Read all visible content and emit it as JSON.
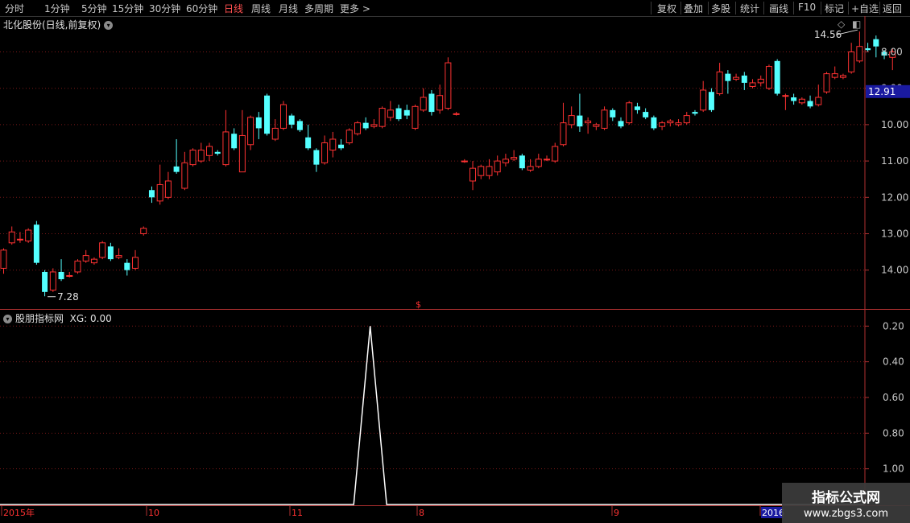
{
  "toolbar": {
    "left": [
      "分时",
      "1分钟",
      "5分钟",
      "15分钟",
      "30分钟",
      "60分钟",
      "日线",
      "周线",
      "月线",
      "多周期",
      "更多 >"
    ],
    "active_index": 6,
    "right": [
      "复权",
      "叠加",
      "多股",
      "统计",
      "画线",
      "F10",
      "标记",
      "+自选",
      "返回"
    ]
  },
  "main_panel": {
    "title": "北化股份(日线,前复权)",
    "current_price_label": "12.91",
    "high_label": "14.56",
    "low_label": "7.28",
    "signal_marker": "$",
    "y_ticks": [
      "14.00",
      "13.00",
      "12.00",
      "11.00",
      "10.00",
      "9.00",
      "8.00"
    ]
  },
  "indicator_panel": {
    "title": "股朋指标网",
    "readout": "XG: 0.00",
    "y_ticks": [
      "1.00",
      "0.80",
      "0.60",
      "0.40",
      "0.20"
    ]
  },
  "date_axis": {
    "labels": [
      "2015年",
      "10",
      "11",
      "8",
      "9",
      "2016"
    ]
  },
  "watermark": {
    "line1": "指标公式网",
    "line2": "www.zbgs3.com"
  },
  "colors": {
    "up": "#ff3232",
    "down": "#54ffff",
    "axis": "#b03030",
    "grid": "#7a1818",
    "text": "#c8c8c8",
    "highlight_bg": "#1a1aa0"
  },
  "chart_data": [
    {
      "type": "candlestick",
      "title": "北化股份(日线,前复权)",
      "ylim": [
        7.0,
        14.7
      ],
      "y_ticks": [
        8,
        9,
        10,
        11,
        12,
        13,
        14
      ],
      "current_price": 12.91,
      "max_label": 14.56,
      "min_label": 7.28,
      "candles": [
        [
          8.05,
          8.55,
          8.6,
          7.9
        ],
        [
          8.75,
          9.05,
          9.2,
          8.7
        ],
        [
          8.85,
          8.85,
          9.05,
          8.75
        ],
        [
          8.8,
          9.1,
          9.15,
          8.75
        ],
        [
          9.25,
          8.2,
          9.35,
          8.15
        ],
        [
          7.95,
          7.4,
          8.0,
          7.28
        ],
        [
          7.45,
          7.95,
          8.05,
          7.4
        ],
        [
          7.95,
          7.75,
          8.3,
          7.7
        ],
        [
          7.85,
          7.85,
          7.95,
          7.8
        ],
        [
          7.95,
          8.25,
          8.3,
          7.9
        ],
        [
          8.25,
          8.4,
          8.55,
          8.2
        ],
        [
          8.2,
          8.3,
          8.35,
          8.15
        ],
        [
          8.35,
          8.75,
          8.8,
          8.3
        ],
        [
          8.65,
          8.3,
          8.75,
          8.25
        ],
        [
          8.35,
          8.4,
          8.6,
          8.3
        ],
        [
          8.2,
          8.0,
          8.3,
          7.85
        ],
        [
          8.05,
          8.35,
          8.55,
          8.0
        ],
        [
          9.0,
          9.15,
          9.2,
          8.95
        ],
        [
          10.2,
          10.0,
          10.3,
          9.85
        ],
        [
          9.9,
          10.35,
          10.9,
          9.8
        ],
        [
          10.0,
          10.45,
          10.7,
          9.95
        ],
        [
          10.85,
          10.7,
          11.6,
          10.65
        ],
        [
          10.25,
          10.95,
          11.25,
          10.2
        ],
        [
          10.9,
          11.3,
          11.35,
          10.85
        ],
        [
          11.0,
          11.3,
          11.5,
          10.95
        ],
        [
          11.15,
          11.4,
          11.5,
          11.0
        ],
        [
          11.25,
          11.2,
          11.3,
          11.15
        ],
        [
          10.9,
          11.8,
          12.4,
          10.85
        ],
        [
          11.75,
          11.35,
          11.9,
          11.3
        ],
        [
          10.7,
          11.7,
          12.4,
          10.7
        ],
        [
          11.45,
          12.2,
          12.25,
          11.3
        ],
        [
          12.2,
          11.9,
          12.35,
          11.6
        ],
        [
          12.8,
          11.75,
          12.85,
          11.7
        ],
        [
          11.6,
          11.9,
          12.15,
          11.55
        ],
        [
          11.9,
          12.55,
          12.65,
          11.85
        ],
        [
          12.25,
          12.0,
          12.3,
          11.9
        ],
        [
          12.1,
          11.85,
          12.15,
          11.8
        ],
        [
          11.65,
          11.35,
          12.0,
          11.3
        ],
        [
          11.3,
          10.9,
          11.35,
          10.7
        ],
        [
          10.95,
          11.5,
          11.7,
          10.9
        ],
        [
          11.3,
          11.6,
          11.8,
          11.1
        ],
        [
          11.45,
          11.35,
          11.6,
          11.3
        ],
        [
          11.5,
          11.85,
          11.9,
          11.45
        ],
        [
          11.75,
          12.05,
          12.1,
          11.7
        ],
        [
          12.05,
          11.9,
          12.2,
          11.85
        ],
        [
          11.95,
          12.0,
          12.15,
          11.9
        ],
        [
          11.95,
          12.45,
          12.5,
          11.9
        ],
        [
          12.2,
          12.4,
          12.65,
          12.1
        ],
        [
          12.45,
          12.15,
          12.55,
          12.1
        ],
        [
          12.4,
          12.25,
          12.55,
          12.15
        ],
        [
          11.9,
          12.5,
          12.55,
          11.85
        ],
        [
          12.4,
          12.75,
          13.0,
          12.35
        ],
        [
          12.85,
          12.35,
          12.95,
          12.25
        ],
        [
          12.4,
          12.8,
          13.1,
          12.3
        ],
        [
          12.45,
          13.7,
          13.85,
          12.4
        ],
        [
          12.3,
          12.3,
          12.35,
          12.25
        ],
        [
          11.0,
          11.0,
          11.05,
          10.95
        ],
        [
          10.45,
          10.8,
          11.0,
          10.2
        ],
        [
          10.6,
          10.85,
          10.9,
          10.5
        ],
        [
          10.6,
          10.85,
          11.05,
          10.5
        ],
        [
          10.7,
          11.0,
          11.15,
          10.6
        ],
        [
          10.95,
          11.05,
          11.2,
          10.85
        ],
        [
          11.05,
          11.1,
          11.3,
          11.0
        ],
        [
          11.15,
          10.8,
          11.2,
          10.75
        ],
        [
          10.75,
          10.85,
          11.05,
          10.7
        ],
        [
          10.85,
          11.05,
          11.2,
          10.8
        ],
        [
          11.05,
          11.05,
          11.15,
          11.0
        ],
        [
          11.0,
          11.4,
          11.5,
          10.95
        ],
        [
          11.45,
          12.05,
          12.6,
          11.4
        ],
        [
          12.0,
          12.25,
          12.5,
          11.9
        ],
        [
          12.25,
          11.95,
          12.85,
          11.8
        ],
        [
          12.05,
          12.1,
          12.2,
          11.75
        ],
        [
          11.95,
          12.0,
          12.05,
          11.85
        ],
        [
          11.9,
          12.4,
          12.5,
          11.85
        ],
        [
          12.4,
          12.2,
          12.45,
          12.1
        ],
        [
          12.1,
          11.95,
          12.2,
          11.9
        ],
        [
          12.05,
          12.6,
          12.65,
          12.0
        ],
        [
          12.5,
          12.4,
          12.6,
          12.3
        ],
        [
          12.35,
          12.2,
          12.45,
          12.15
        ],
        [
          12.2,
          11.9,
          12.25,
          11.85
        ],
        [
          11.95,
          12.05,
          12.1,
          11.85
        ],
        [
          12.05,
          12.1,
          12.15,
          11.95
        ],
        [
          12.0,
          12.05,
          12.15,
          11.95
        ],
        [
          12.05,
          12.25,
          12.35,
          12.0
        ],
        [
          12.35,
          12.3,
          12.4,
          12.25
        ],
        [
          12.4,
          12.95,
          13.2,
          12.35
        ],
        [
          12.9,
          12.4,
          13.0,
          12.35
        ],
        [
          12.85,
          13.45,
          13.7,
          12.8
        ],
        [
          13.4,
          13.2,
          13.5,
          12.85
        ],
        [
          13.25,
          13.3,
          13.4,
          13.2
        ],
        [
          13.35,
          13.15,
          13.45,
          12.95
        ],
        [
          13.05,
          13.15,
          13.25,
          13.0
        ],
        [
          13.15,
          13.25,
          13.35,
          13.05
        ],
        [
          13.0,
          13.6,
          13.65,
          12.95
        ],
        [
          13.75,
          12.85,
          13.8,
          12.8
        ],
        [
          12.8,
          12.8,
          12.85,
          12.4
        ],
        [
          12.75,
          12.65,
          12.85,
          12.55
        ],
        [
          12.6,
          12.7,
          12.75,
          12.55
        ],
        [
          12.65,
          12.5,
          12.8,
          12.45
        ],
        [
          12.55,
          12.75,
          13.1,
          12.5
        ],
        [
          12.9,
          13.4,
          13.45,
          12.85
        ],
        [
          13.3,
          13.4,
          13.6,
          13.25
        ],
        [
          13.3,
          13.35,
          13.4,
          13.25
        ],
        [
          13.45,
          14.0,
          14.25,
          13.4
        ],
        [
          13.75,
          14.15,
          14.56,
          13.7
        ],
        [
          14.1,
          14.05,
          14.25,
          14.0
        ],
        [
          14.35,
          14.15,
          14.45,
          13.85
        ],
        [
          14.0,
          13.9,
          14.05,
          13.8
        ],
        [
          13.85,
          14.0,
          14.1,
          13.5
        ]
      ]
    },
    {
      "type": "line",
      "title": "股朋指标网",
      "series": [
        {
          "name": "XG",
          "x": [
            0,
            42,
            44,
            46,
            77
          ],
          "y": [
            0,
            0,
            1,
            0,
            0
          ]
        }
      ],
      "ylim": [
        0,
        1.05
      ],
      "y_ticks": [
        0.2,
        0.4,
        0.6,
        0.8,
        1.0
      ]
    }
  ]
}
